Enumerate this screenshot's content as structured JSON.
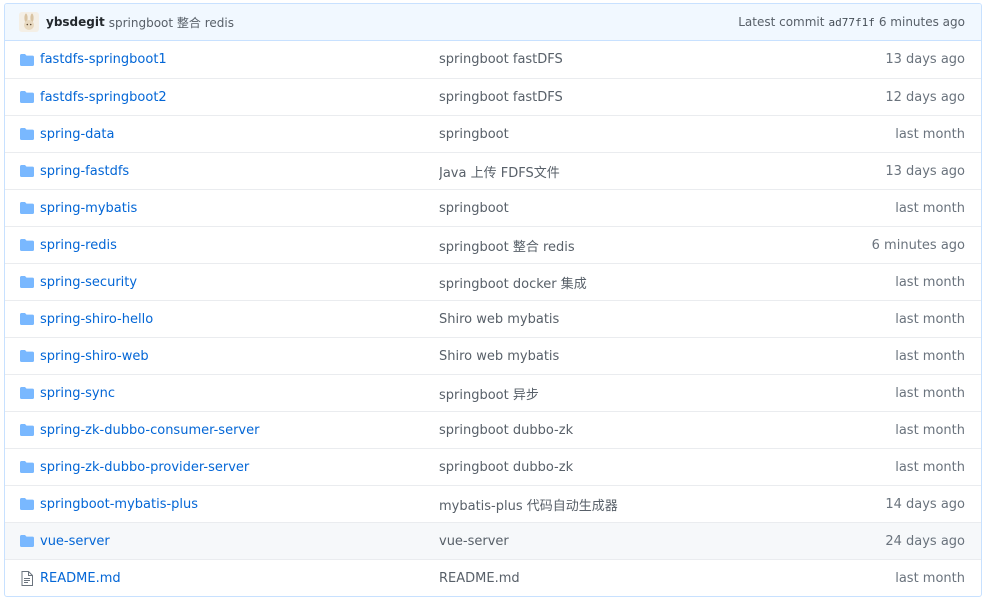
{
  "commit": {
    "author": "ybsdegit",
    "message": "springboot 整合 redis",
    "latest_label": "Latest commit",
    "sha": "ad77f1f",
    "age": "6 minutes ago"
  },
  "colors": {
    "link": "#0366d6",
    "folder": "#79b8ff",
    "header_bg": "#f1f8ff",
    "border": "#c8e1ff"
  },
  "files": [
    {
      "type": "folder",
      "icon": "folder-icon",
      "name": "fastdfs-springboot1",
      "message": "springboot fastDFS",
      "age": "13 days ago"
    },
    {
      "type": "folder",
      "icon": "folder-icon",
      "name": "fastdfs-springboot2",
      "message": "springboot fastDFS",
      "age": "12 days ago"
    },
    {
      "type": "folder",
      "icon": "folder-icon",
      "name": "spring-data",
      "message": "springboot",
      "age": "last month"
    },
    {
      "type": "folder",
      "icon": "folder-icon",
      "name": "spring-fastdfs",
      "message": "Java 上传 FDFS文件",
      "age": "13 days ago"
    },
    {
      "type": "folder",
      "icon": "folder-icon",
      "name": "spring-mybatis",
      "message": "springboot",
      "age": "last month"
    },
    {
      "type": "folder",
      "icon": "folder-icon",
      "name": "spring-redis",
      "message": "springboot 整合 redis",
      "age": "6 minutes ago"
    },
    {
      "type": "folder",
      "icon": "folder-icon",
      "name": "spring-security",
      "message": "springboot docker 集成",
      "age": "last month"
    },
    {
      "type": "folder",
      "icon": "folder-icon",
      "name": "spring-shiro-hello",
      "message": "Shiro web mybatis",
      "age": "last month"
    },
    {
      "type": "folder",
      "icon": "folder-icon",
      "name": "spring-shiro-web",
      "message": "Shiro web mybatis",
      "age": "last month"
    },
    {
      "type": "folder",
      "icon": "folder-icon",
      "name": "spring-sync",
      "message": "springboot 异步",
      "age": "last month"
    },
    {
      "type": "folder",
      "icon": "folder-icon",
      "name": "spring-zk-dubbo-consumer-server",
      "message": "springboot dubbo-zk",
      "age": "last month"
    },
    {
      "type": "folder",
      "icon": "folder-icon",
      "name": "spring-zk-dubbo-provider-server",
      "message": "springboot dubbo-zk",
      "age": "last month"
    },
    {
      "type": "folder",
      "icon": "folder-icon",
      "name": "springboot-mybatis-plus",
      "message": "mybatis-plus 代码自动生成器",
      "age": "14 days ago"
    },
    {
      "type": "folder",
      "icon": "folder-icon",
      "name": "vue-server",
      "message": "vue-server",
      "age": "24 days ago",
      "hover": true
    },
    {
      "type": "file",
      "icon": "file-text-icon",
      "name": "README.md",
      "message": "README.md",
      "age": "last month"
    }
  ]
}
